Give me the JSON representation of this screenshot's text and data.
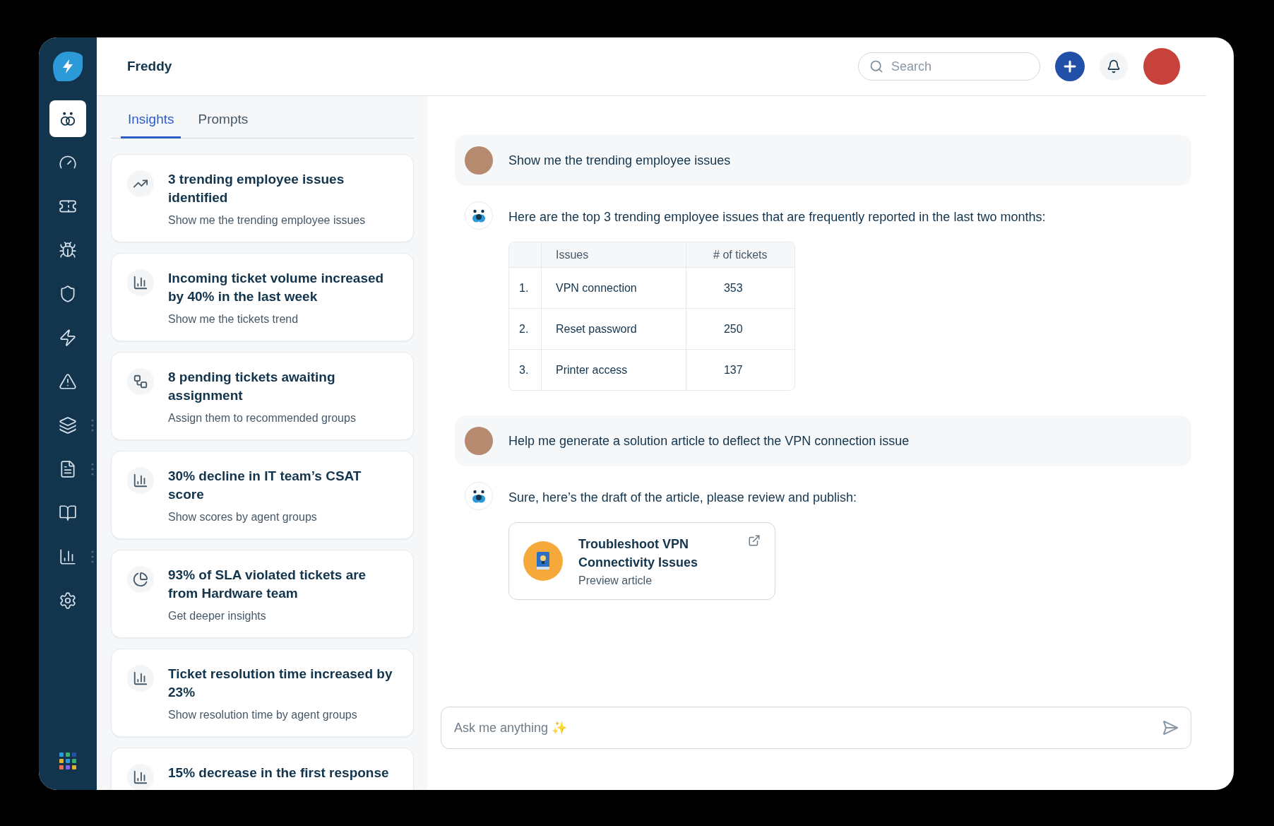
{
  "sidebar": {
    "items": [
      {
        "selected": true,
        "handle": false
      },
      {
        "selected": false,
        "handle": false
      },
      {
        "selected": false,
        "handle": false
      },
      {
        "selected": false,
        "handle": false
      },
      {
        "selected": false,
        "handle": false
      },
      {
        "selected": false,
        "handle": false
      },
      {
        "selected": false,
        "handle": false
      },
      {
        "selected": false,
        "handle": true
      },
      {
        "selected": false,
        "handle": true
      },
      {
        "selected": false,
        "handle": false
      },
      {
        "selected": false,
        "handle": true
      },
      {
        "selected": false,
        "handle": false
      }
    ]
  },
  "header": {
    "title": "Freddy",
    "search": {
      "placeholder": "Search"
    }
  },
  "tabs": [
    {
      "label": "Insights",
      "selected": true
    },
    {
      "label": "Prompts",
      "selected": false
    }
  ],
  "insights": [
    {
      "kind": "trend",
      "title": "3 trending employee issues identified",
      "action": "Show me the trending employee issues"
    },
    {
      "kind": "bars",
      "title": "Incoming ticket volume increased by 40% in the last week",
      "action": "Show me the tickets trend"
    },
    {
      "kind": "flow",
      "title": "8 pending tickets awaiting assignment",
      "action": "Assign them to recommended groups"
    },
    {
      "kind": "bars",
      "title": "30% decline in IT team’s CSAT score",
      "action": "Show scores by agent groups"
    },
    {
      "kind": "pie",
      "title": "93% of SLA violated tickets are from Hardware team",
      "action": "Get deeper insights"
    },
    {
      "kind": "bars",
      "title": "Ticket resolution time increased by 23%",
      "action": "Show resolution time by agent groups"
    },
    {
      "kind": "bars",
      "title": "15% decrease in the first response"
    }
  ],
  "messages": [
    {
      "kind": "user",
      "text": "Show me the trending employee issues"
    },
    {
      "kind": "bot",
      "text": "Here are the top 3 trending employee issues that are frequently reported in the last two months:",
      "table": {
        "columns": [
          "",
          "Issues",
          "# of tickets"
        ],
        "rows": [
          [
            "1.",
            "VPN connection",
            "353"
          ],
          [
            "2.",
            "Reset password",
            "250"
          ],
          [
            "3.",
            "Printer access",
            "137"
          ]
        ]
      }
    },
    {
      "kind": "user",
      "text": "Help me generate a solution article to deflect the VPN connection issue"
    },
    {
      "kind": "bot",
      "text": "Sure, here’s the draft of the article, please review and publish:",
      "article": {
        "title": "Troubleshoot VPN Connectivity Issues",
        "link": "Preview article"
      }
    }
  ],
  "composer": {
    "placeholder": "Ask me anything ✨"
  }
}
